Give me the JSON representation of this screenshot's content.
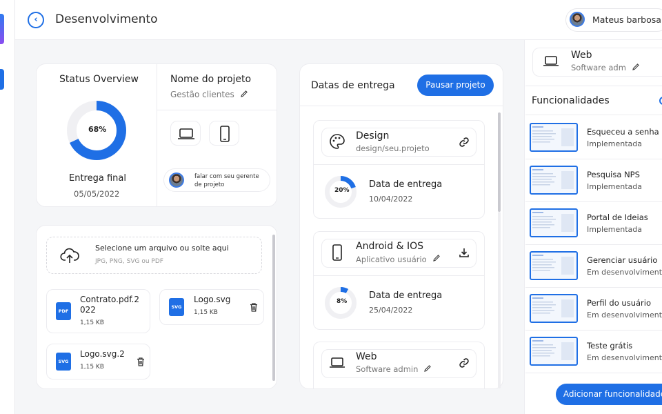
{
  "header": {
    "title": "Desenvolvimento",
    "user_name": "Mateus barbosa"
  },
  "status": {
    "title": "Status Overview",
    "percent_label": "68%",
    "percent": 68,
    "delivery_label": "Entrega final",
    "delivery_date": "05/05/2022"
  },
  "project": {
    "name_label": "Nome do projeto",
    "name_value": "Gestão clientes",
    "manager_text_1": "falar com seu gerente",
    "manager_text_2": "de projeto"
  },
  "upload": {
    "title": "Selecione um arquivo ou solte aqui",
    "hint": "JPG, PNG, SVG ou PDF",
    "files": [
      {
        "name_1": "Contrato.pdf.2",
        "name_2": "022",
        "size": "1,15 KB",
        "type": "PDF"
      },
      {
        "name_1": "Logo.svg",
        "size": "1,15 KB",
        "type": "SVG"
      },
      {
        "name_1": "Logo.svg.2",
        "size": "1,15 KB",
        "type": "SVG"
      }
    ]
  },
  "deliveries": {
    "title": "Datas de entrega",
    "pause_label": "Pausar projeto",
    "items": [
      {
        "name": "Design",
        "sub": "design/seu.projeto",
        "date_label": "Data de entrega",
        "date": "10/04/2022",
        "percent_label": "20%",
        "percent": 20
      },
      {
        "name": "Android & IOS",
        "sub": "Aplicativo usuário",
        "date_label": "Data de entrega",
        "date": "25/04/2022",
        "percent_label": "8%",
        "percent": 8
      },
      {
        "name": "Web",
        "sub": "Software admin"
      }
    ]
  },
  "features": {
    "top_name": "Web",
    "top_sub": "Software adm",
    "title": "Funcionalidades",
    "add_label": "Adicionar funcionalidade",
    "items": [
      {
        "name": "Esqueceu a senha",
        "status": "Implementada"
      },
      {
        "name": "Pesquisa NPS",
        "status": "Implementada"
      },
      {
        "name": "Portal de Ideias",
        "status": "Implementada"
      },
      {
        "name": "Gerenciar usuário",
        "status": "Em desenvolvimento"
      },
      {
        "name": "Perfil do usuário",
        "status": "Em desenvolvimento"
      },
      {
        "name": "Teste grátis",
        "status": "Em desenvolvimento"
      }
    ]
  },
  "colors": {
    "accent": "#1f6fe5",
    "ring_track": "#f0f0f3"
  }
}
